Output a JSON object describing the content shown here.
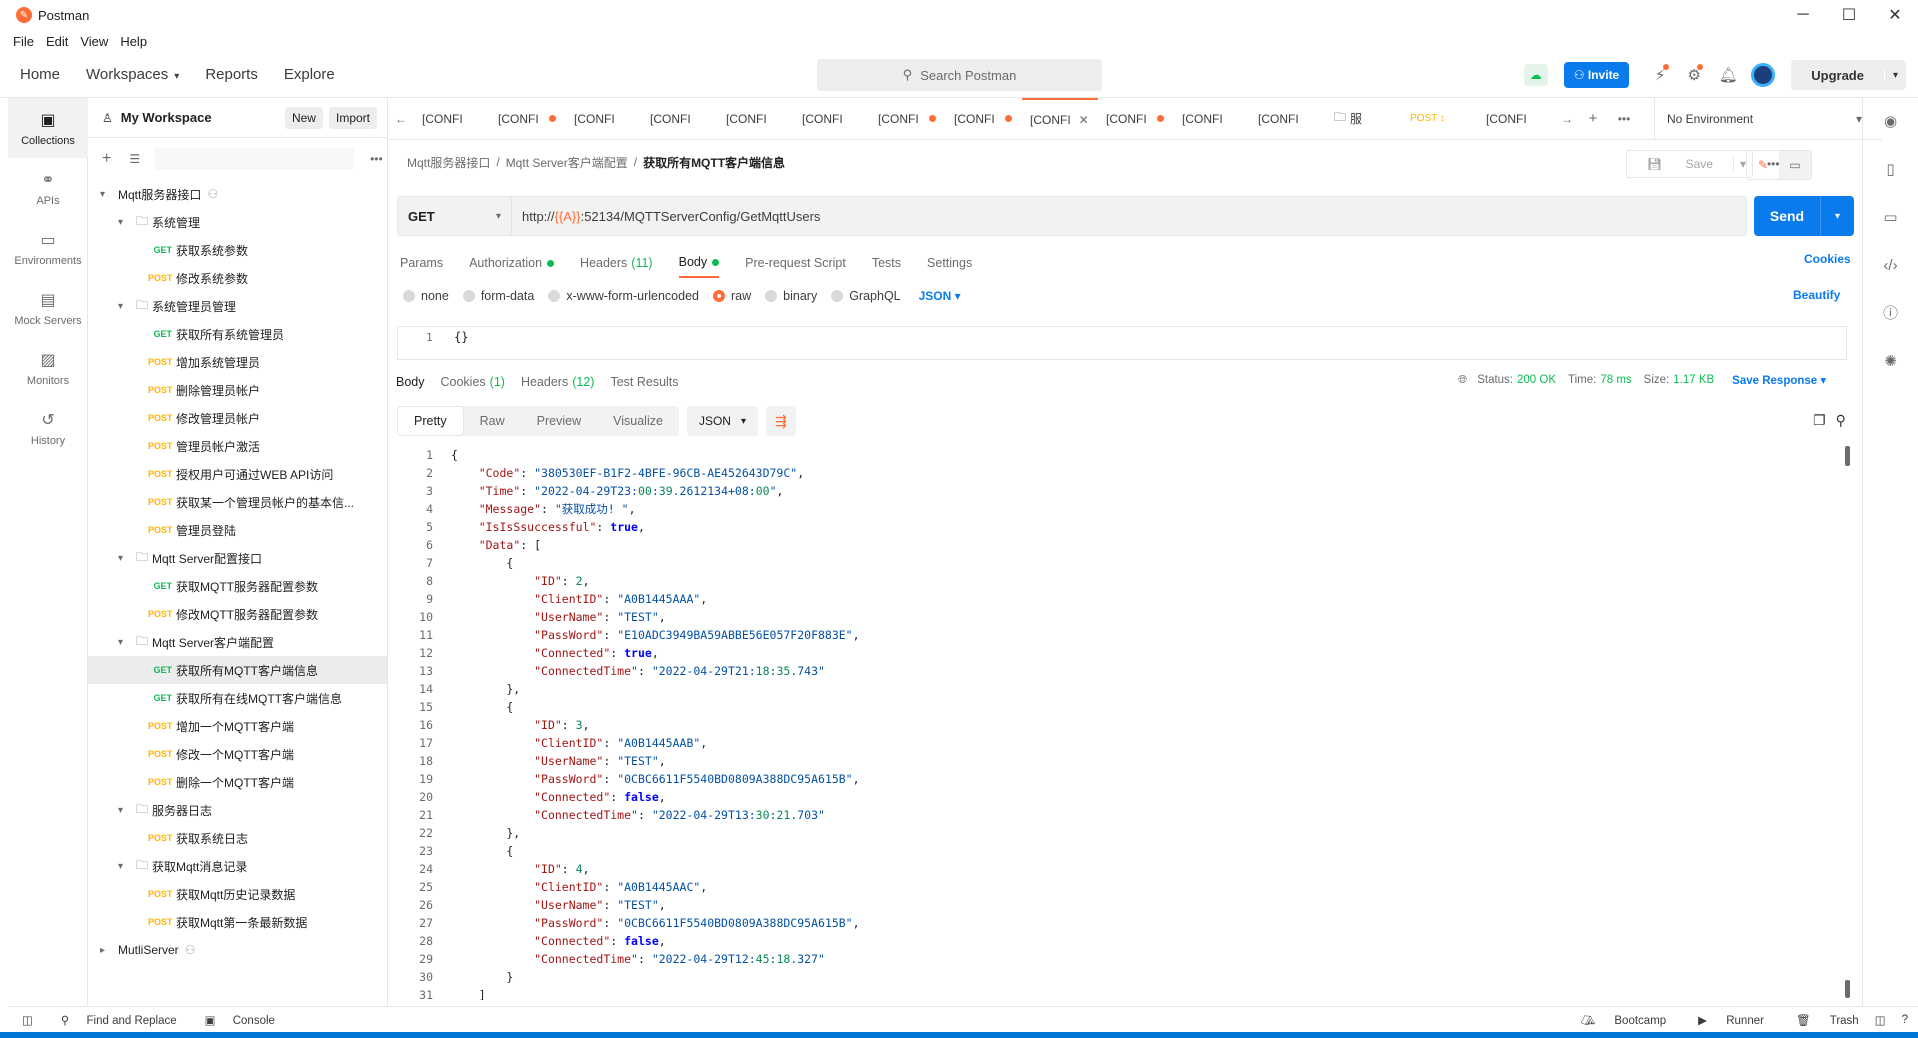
{
  "app": {
    "title": "Postman"
  },
  "menu": [
    "File",
    "Edit",
    "View",
    "Help"
  ],
  "header": {
    "nav": [
      "Home",
      "Workspaces",
      "Reports",
      "Explore"
    ],
    "search_placeholder": "Search Postman",
    "invite_label": "Invite",
    "upgrade_label": "Upgrade"
  },
  "rail": [
    {
      "label": "Collections",
      "icon": "collections-icon"
    },
    {
      "label": "APIs",
      "icon": "apis-icon"
    },
    {
      "label": "Environments",
      "icon": "environments-icon"
    },
    {
      "label": "Mock Servers",
      "icon": "mock-servers-icon"
    },
    {
      "label": "Monitors",
      "icon": "monitors-icon"
    },
    {
      "label": "History",
      "icon": "history-icon"
    }
  ],
  "workspace": {
    "name": "My Workspace",
    "new_label": "New",
    "import_label": "Import"
  },
  "tree": [
    {
      "type": "collection",
      "label": "Mqtt服务器接口",
      "indent": 0,
      "expanded": true
    },
    {
      "type": "folder",
      "label": "系统管理",
      "indent": 1
    },
    {
      "type": "request",
      "method": "GET",
      "label": "获取系统参数",
      "indent": 2
    },
    {
      "type": "request",
      "method": "POST",
      "label": "修改系统参数",
      "indent": 2
    },
    {
      "type": "folder",
      "label": "系统管理员管理",
      "indent": 1
    },
    {
      "type": "request",
      "method": "GET",
      "label": "获取所有系统管理员",
      "indent": 2
    },
    {
      "type": "request",
      "method": "POST",
      "label": "增加系统管理员",
      "indent": 2
    },
    {
      "type": "request",
      "method": "POST",
      "label": "删除管理员帐户",
      "indent": 2
    },
    {
      "type": "request",
      "method": "POST",
      "label": "修改管理员帐户",
      "indent": 2
    },
    {
      "type": "request",
      "method": "POST",
      "label": "管理员帐户激活",
      "indent": 2
    },
    {
      "type": "request",
      "method": "POST",
      "label": "授权用户可通过WEB API访问",
      "indent": 2
    },
    {
      "type": "request",
      "method": "POST",
      "label": "获取某一个管理员帐户的基本信...",
      "indent": 2
    },
    {
      "type": "request",
      "method": "POST",
      "label": "管理员登陆",
      "indent": 2
    },
    {
      "type": "folder",
      "label": "Mqtt Server配置接口",
      "indent": 1
    },
    {
      "type": "request",
      "method": "GET",
      "label": "获取MQTT服务器配置参数",
      "indent": 2
    },
    {
      "type": "request",
      "method": "POST",
      "label": "修改MQTT服务器配置参数",
      "indent": 2
    },
    {
      "type": "folder",
      "label": "Mqtt Server客户端配置",
      "indent": 1
    },
    {
      "type": "request",
      "method": "GET",
      "label": "获取所有MQTT客户端信息",
      "indent": 2,
      "selected": true
    },
    {
      "type": "request",
      "method": "GET",
      "label": "获取所有在线MQTT客户端信息",
      "indent": 2
    },
    {
      "type": "request",
      "method": "POST",
      "label": "增加一个MQTT客户端",
      "indent": 2
    },
    {
      "type": "request",
      "method": "POST",
      "label": "修改一个MQTT客户端",
      "indent": 2
    },
    {
      "type": "request",
      "method": "POST",
      "label": "删除一个MQTT客户端",
      "indent": 2
    },
    {
      "type": "folder",
      "label": "服务器日志",
      "indent": 1
    },
    {
      "type": "request",
      "method": "POST",
      "label": "获取系统日志",
      "indent": 2
    },
    {
      "type": "folder",
      "label": "获取Mqtt消息记录",
      "indent": 1
    },
    {
      "type": "request",
      "method": "POST",
      "label": "获取Mqtt历史记录数据",
      "indent": 2
    },
    {
      "type": "request",
      "method": "POST",
      "label": "获取Mqtt第一条最新数据",
      "indent": 2
    },
    {
      "type": "collection",
      "label": "MutliServer",
      "indent": 0,
      "expanded": false
    }
  ],
  "tabs": [
    {
      "label": "[CONFI",
      "dirty": false
    },
    {
      "label": "[CONFI",
      "dirty": true
    },
    {
      "label": "[CONFI",
      "dirty": false
    },
    {
      "label": "[CONFI",
      "dirty": false
    },
    {
      "label": "[CONFI",
      "dirty": false
    },
    {
      "label": "[CONFI",
      "dirty": false
    },
    {
      "label": "[CONFI",
      "dirty": true
    },
    {
      "label": "[CONFI",
      "dirty": true
    },
    {
      "label": "[CONFI",
      "dirty": false,
      "active": true
    },
    {
      "label": "[CONFI",
      "dirty": true
    },
    {
      "label": "[CONFI",
      "dirty": false
    },
    {
      "label": "[CONFI",
      "dirty": false
    },
    {
      "label": "服",
      "dirty": false,
      "folder": true
    },
    {
      "label": "POST ↕",
      "dirty": false,
      "post": true
    },
    {
      "label": "[CONFI",
      "dirty": false
    }
  ],
  "environment": "No Environment",
  "breadcrumb": [
    "Mqtt服务器接口",
    "Mqtt Server客户端配置",
    "获取所有MQTT客户端信息"
  ],
  "save_label": "Save",
  "request": {
    "method": "GET",
    "url_prefix": "http://",
    "url_var": "{{A}}",
    "url_suffix": ":52134/MQTTServerConfig/GetMqttUsers",
    "send_label": "Send"
  },
  "req_tabs": [
    {
      "label": "Params"
    },
    {
      "label": "Authorization",
      "dot": true
    },
    {
      "label": "Headers",
      "count": "(11)"
    },
    {
      "label": "Body",
      "dot": true,
      "active": true
    },
    {
      "label": "Pre-request Script"
    },
    {
      "label": "Tests"
    },
    {
      "label": "Settings"
    }
  ],
  "cookies_label": "Cookies",
  "body_types": [
    {
      "label": "none"
    },
    {
      "label": "form-data"
    },
    {
      "label": "x-www-form-urlencoded"
    },
    {
      "label": "raw",
      "on": true
    },
    {
      "label": "binary"
    },
    {
      "label": "GraphQL"
    }
  ],
  "body_format": "JSON",
  "beautify_label": "Beautify",
  "req_body": {
    "line": "1",
    "code": "{}"
  },
  "res_tabs": [
    {
      "label": "Body",
      "active": true
    },
    {
      "label": "Cookies",
      "count": "(1)"
    },
    {
      "label": "Headers",
      "count": "(12)"
    },
    {
      "label": "Test Results"
    }
  ],
  "res_status": {
    "status_label": "Status:",
    "status": "200 OK",
    "time_label": "Time:",
    "time": "78 ms",
    "size_label": "Size:",
    "size": "1.17 KB",
    "save_response": "Save Response"
  },
  "view_modes": [
    "Pretty",
    "Raw",
    "Preview",
    "Visualize"
  ],
  "res_format": "JSON",
  "response_lines": [
    "{",
    "    \"Code\": \"380530EF-B1F2-4BFE-96CB-AE452643D79C\",",
    "    \"Time\": \"2022-04-29T23:00:39.2612134+08:00\",",
    "    \"Message\": \"获取成功! \",",
    "    \"IsIsSsuccessful\": true,",
    "    \"Data\": [",
    "        {",
    "            \"ID\": 2,",
    "            \"ClientID\": \"A0B1445AAA\",",
    "            \"UserName\": \"TEST\",",
    "            \"PassWord\": \"E10ADC3949BA59ABBE56E057F20F883E\",",
    "            \"Connected\": true,",
    "            \"ConnectedTime\": \"2022-04-29T21:18:35.743\"",
    "        },",
    "        {",
    "            \"ID\": 3,",
    "            \"ClientID\": \"A0B1445AAB\",",
    "            \"UserName\": \"TEST\",",
    "            \"PassWord\": \"0CBC6611F5540BD0809A388DC95A615B\",",
    "            \"Connected\": false,",
    "            \"ConnectedTime\": \"2022-04-29T13:30:21.703\"",
    "        },",
    "        {",
    "            \"ID\": 4,",
    "            \"ClientID\": \"A0B1445AAC\",",
    "            \"UserName\": \"TEST\",",
    "            \"PassWord\": \"0CBC6611F5540BD0809A388DC95A615B\",",
    "            \"Connected\": false,",
    "            \"ConnectedTime\": \"2022-04-29T12:45:18.327\"",
    "        }",
    "    ]"
  ],
  "footer": {
    "find_replace": "Find and Replace",
    "console": "Console",
    "bootcamp": "Bootcamp",
    "runner": "Runner",
    "trash": "Trash"
  },
  "colors": {
    "accent": "#ff6c37",
    "primary": "#097bed",
    "get": "#0cbb52",
    "post": "#ffb400"
  }
}
